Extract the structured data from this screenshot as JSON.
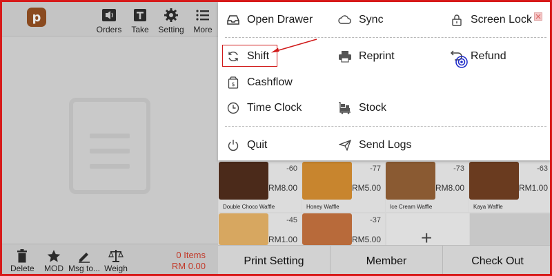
{
  "topbar": {
    "logo_letter": "p",
    "buttons": [
      {
        "label": "Orders",
        "icon": "speaker-icon"
      },
      {
        "label": "Take",
        "icon": "take-icon"
      },
      {
        "label": "Setting",
        "icon": "gear-icon"
      },
      {
        "label": "More",
        "icon": "list-icon"
      }
    ]
  },
  "bottombar": {
    "buttons": [
      {
        "label": "Delete",
        "icon": "trash-icon"
      },
      {
        "label": "MOD",
        "icon": "star-icon"
      },
      {
        "label": "Msg to...",
        "icon": "pencil-icon"
      },
      {
        "label": "Weigh",
        "icon": "scale-icon"
      }
    ],
    "items_count": "0 Items",
    "total": "RM 0.00"
  },
  "menu": {
    "items": [
      {
        "label": "Open Drawer",
        "icon": "drawer-icon"
      },
      {
        "label": "Sync",
        "icon": "cloud-icon"
      },
      {
        "label": "Screen Lock",
        "icon": "lock-icon"
      },
      {
        "label": "Shift",
        "icon": "refresh-icon"
      },
      {
        "label": "Reprint",
        "icon": "printer-icon"
      },
      {
        "label": "Refund",
        "icon": "refund-icon"
      },
      {
        "label": "Cashflow",
        "icon": "cash-icon"
      },
      {
        "label": "Time Clock",
        "icon": "clock-icon"
      },
      {
        "label": "Stock",
        "icon": "stock-icon"
      },
      {
        "label": "Quit",
        "icon": "power-icon"
      },
      {
        "label": "Send Logs",
        "icon": "send-icon"
      }
    ]
  },
  "products": [
    {
      "name": "Double Choco Waffle",
      "count": "-60",
      "price": "RM8.00",
      "color": "#4b2a1a"
    },
    {
      "name": "Honey Waffle",
      "count": "-77",
      "price": "RM5.00",
      "color": "#c8852e"
    },
    {
      "name": "Ice Cream Waffle",
      "count": "-73",
      "price": "RM8.00",
      "color": "#8a5a32"
    },
    {
      "name": "Kaya Waffle",
      "count": "-63",
      "price": "RM1.00",
      "color": "#6a3b1f"
    },
    {
      "name": "",
      "count": "-45",
      "price": "RM1.00",
      "color": "#d7a760"
    },
    {
      "name": "",
      "count": "-37",
      "price": "RM5.00",
      "color": "#b86a3a"
    }
  ],
  "add_tile": "+",
  "actions": {
    "print_setting": "Print Setting",
    "member": "Member",
    "check_out": "Check Out"
  },
  "colors": {
    "accent_red": "#d01a1a",
    "total_red": "#c23a2a",
    "logo_orange": "#8a4a1f"
  }
}
